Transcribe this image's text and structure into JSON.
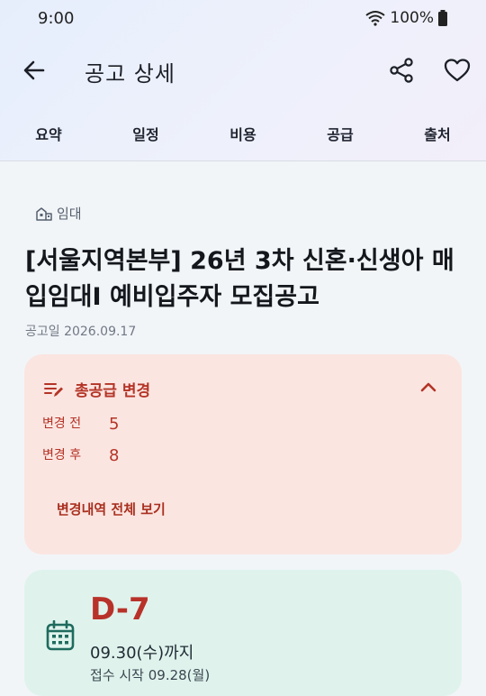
{
  "status_bar": {
    "time": "9:00",
    "battery": "100%"
  },
  "app_bar": {
    "title": "공고 상세"
  },
  "tabs": [
    {
      "label": "요약"
    },
    {
      "label": "일정"
    },
    {
      "label": "비용"
    },
    {
      "label": "공급"
    },
    {
      "label": "출처"
    }
  ],
  "notice": {
    "category": "임대",
    "title": "[서울지역본부] 26년 3차 신혼·신생아 매입임대I 예비입주자 모집공고",
    "date": "공고일 2026.09.17"
  },
  "change": {
    "heading": "총공급 변경",
    "before_label": "변경 전",
    "before_value": "5",
    "after_label": "변경 후",
    "after_value": "8",
    "link": "변경내역 전체 보기",
    "accent_color": "#b43426",
    "background": "#fbe5e1"
  },
  "deadline": {
    "dday": "D-7",
    "due": "09.30(수)까지",
    "start": "접수 시작 09.28(월)",
    "background": "#dff3ec"
  },
  "icons": [
    "back-arrow-icon",
    "share-icon",
    "heart-icon",
    "building-icon",
    "edit-list-icon",
    "chevron-up-icon",
    "calendar-icon",
    "wifi-icon",
    "battery-icon"
  ]
}
